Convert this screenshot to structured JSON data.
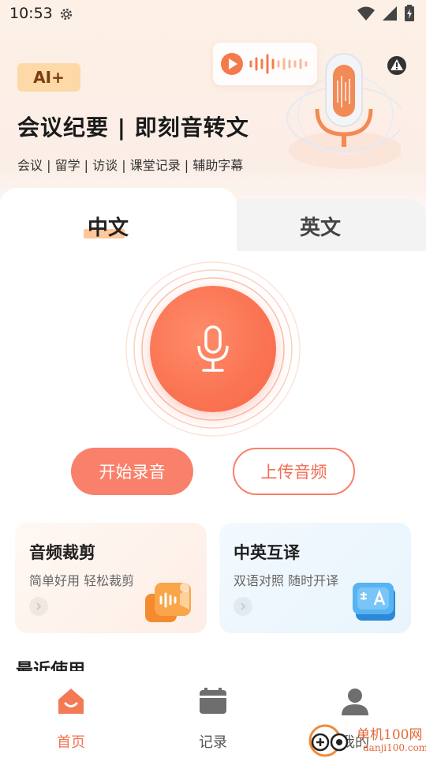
{
  "status_bar": {
    "time": "10:53",
    "icons": [
      "gear-icon",
      "wifi-icon",
      "signal-icon",
      "battery-icon"
    ]
  },
  "header": {
    "badge": "AI+",
    "title": "会议纪要 | 即刻音转文",
    "subtitle": "会议 | 留学 | 访谈 | 课堂记录 | 辅助字幕",
    "warning_icon": "alert-icon"
  },
  "tabs": [
    {
      "label": "中文",
      "active": true
    },
    {
      "label": "英文",
      "active": false
    }
  ],
  "actions": {
    "start_label": "开始录音",
    "upload_label": "上传音频"
  },
  "cards": [
    {
      "title": "音频裁剪",
      "subtitle": "简单好用 轻松裁剪",
      "icon": "video-audio-icon"
    },
    {
      "title": "中英互译",
      "subtitle": "双语对照 随时开译",
      "icon": "translate-icon"
    }
  ],
  "recent_title": "最近使用",
  "bottom_nav": [
    {
      "label": "首页",
      "icon": "home-icon",
      "active": true
    },
    {
      "label": "记录",
      "icon": "calendar-icon",
      "active": false
    },
    {
      "label": "我的",
      "icon": "user-icon",
      "active": false
    }
  ],
  "watermark": {
    "line1": "单机100网",
    "line2": "danji100.com"
  },
  "colors": {
    "accent": "#f9806a",
    "accent_dark": "#f26f56",
    "badge_bg": "#fcd9a6",
    "nav_active": "#f3724f"
  }
}
